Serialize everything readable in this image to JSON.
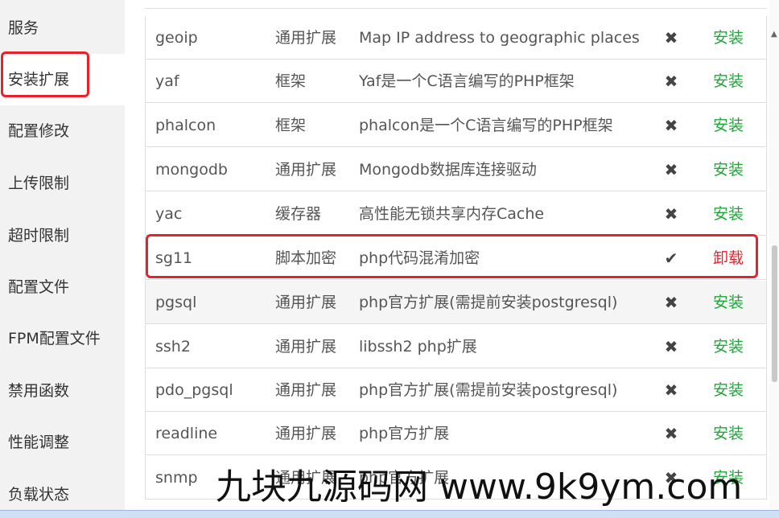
{
  "sidebar": {
    "items": [
      {
        "label": "服务"
      },
      {
        "label": "安装扩展"
      },
      {
        "label": "配置修改"
      },
      {
        "label": "上传限制"
      },
      {
        "label": "超时限制"
      },
      {
        "label": "配置文件"
      },
      {
        "label": "FPM配置文件"
      },
      {
        "label": "禁用函数"
      },
      {
        "label": "性能调整"
      },
      {
        "label": "负载状态"
      }
    ],
    "active_index": 1
  },
  "extensions": {
    "rows": [
      {
        "name": "geoip",
        "type": "通用扩展",
        "desc": "Map IP address to geographic places",
        "status": "✖",
        "installed": false,
        "action": "安装"
      },
      {
        "name": "yaf",
        "type": "框架",
        "desc": "Yaf是一个C语言编写的PHP框架",
        "status": "✖",
        "installed": false,
        "action": "安装"
      },
      {
        "name": "phalcon",
        "type": "框架",
        "desc": "phalcon是一个C语言编写的PHP框架",
        "status": "✖",
        "installed": false,
        "action": "安装"
      },
      {
        "name": "mongodb",
        "type": "通用扩展",
        "desc": "Mongodb数据库连接驱动",
        "status": "✖",
        "installed": false,
        "action": "安装"
      },
      {
        "name": "yac",
        "type": "缓存器",
        "desc": "高性能无锁共享内存Cache",
        "status": "✖",
        "installed": false,
        "action": "安装"
      },
      {
        "name": "sg11",
        "type": "脚本加密",
        "desc": "php代码混淆加密",
        "status": "✔",
        "installed": true,
        "action": "卸载"
      },
      {
        "name": "pgsql",
        "type": "通用扩展",
        "desc": "php官方扩展(需提前安装postgresql)",
        "status": "✖",
        "installed": false,
        "action": "安装"
      },
      {
        "name": "ssh2",
        "type": "通用扩展",
        "desc": "libssh2 php扩展",
        "status": "✖",
        "installed": false,
        "action": "安装"
      },
      {
        "name": "pdo_pgsql",
        "type": "通用扩展",
        "desc": "php官方扩展(需提前安装postgresql)",
        "status": "✖",
        "installed": false,
        "action": "安装"
      },
      {
        "name": "readline",
        "type": "通用扩展",
        "desc": "php官方扩展",
        "status": "✖",
        "installed": false,
        "action": "安装"
      },
      {
        "name": "snmp",
        "type": "通用扩展",
        "desc": "php官方扩展",
        "status": "✖",
        "installed": false,
        "action": "安装"
      }
    ]
  },
  "watermark": {
    "text": "九块九源码网 www.9k9ym.com"
  },
  "colors": {
    "install": "#20a53a",
    "uninstall": "#e8222a",
    "highlight": "#e8222a",
    "sidebar_bg": "#f2f2f2"
  },
  "icons": {
    "not_installed": "x-mark-icon",
    "installed": "check-icon"
  }
}
